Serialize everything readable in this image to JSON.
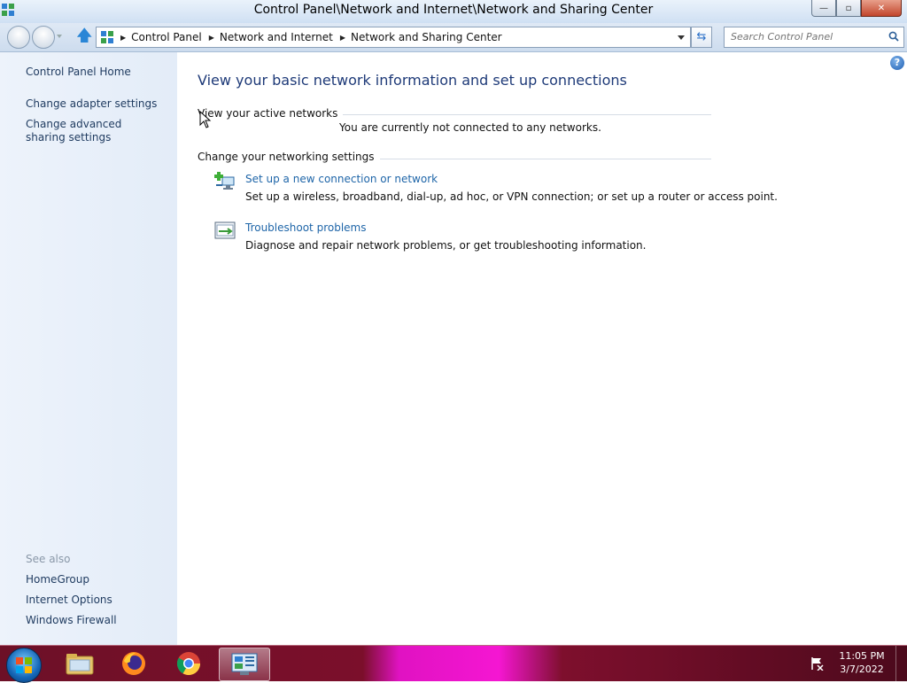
{
  "window": {
    "title": "Control Panel\\Network and Internet\\Network and Sharing Center",
    "minimize_label": "—",
    "restore_label": "▫",
    "close_label": "✕"
  },
  "address": {
    "crumbs": [
      "Control Panel",
      "Network and Internet",
      "Network and Sharing Center"
    ]
  },
  "search": {
    "placeholder": "Search Control Panel"
  },
  "sidebar": {
    "links": [
      "Control Panel Home",
      "Change adapter settings",
      "Change advanced sharing settings"
    ],
    "see_also_label": "See also",
    "see_also": [
      "HomeGroup",
      "Internet Options",
      "Windows Firewall"
    ]
  },
  "main": {
    "title": "View your basic network information and set up connections",
    "active_networks_heading": "View your active networks",
    "not_connected_text": "You are currently not connected to any networks.",
    "change_settings_heading": "Change your networking settings",
    "tasks": [
      {
        "link": "Set up a new connection or network",
        "description": "Set up a wireless, broadband, dial-up, ad hoc, or VPN connection; or set up a router or access point.",
        "icon": "network-setup-icon"
      },
      {
        "link": "Troubleshoot problems",
        "description": "Diagnose and repair network problems, or get troubleshooting information.",
        "icon": "troubleshoot-icon"
      }
    ],
    "help_label": "?"
  },
  "taskbar": {
    "pinned": [
      "file-explorer-icon",
      "firefox-icon",
      "chrome-icon",
      "control-panel-icon"
    ],
    "clock_time": "11:05 PM",
    "clock_date": "3/7/2022",
    "accent": "#7b0f2b"
  }
}
